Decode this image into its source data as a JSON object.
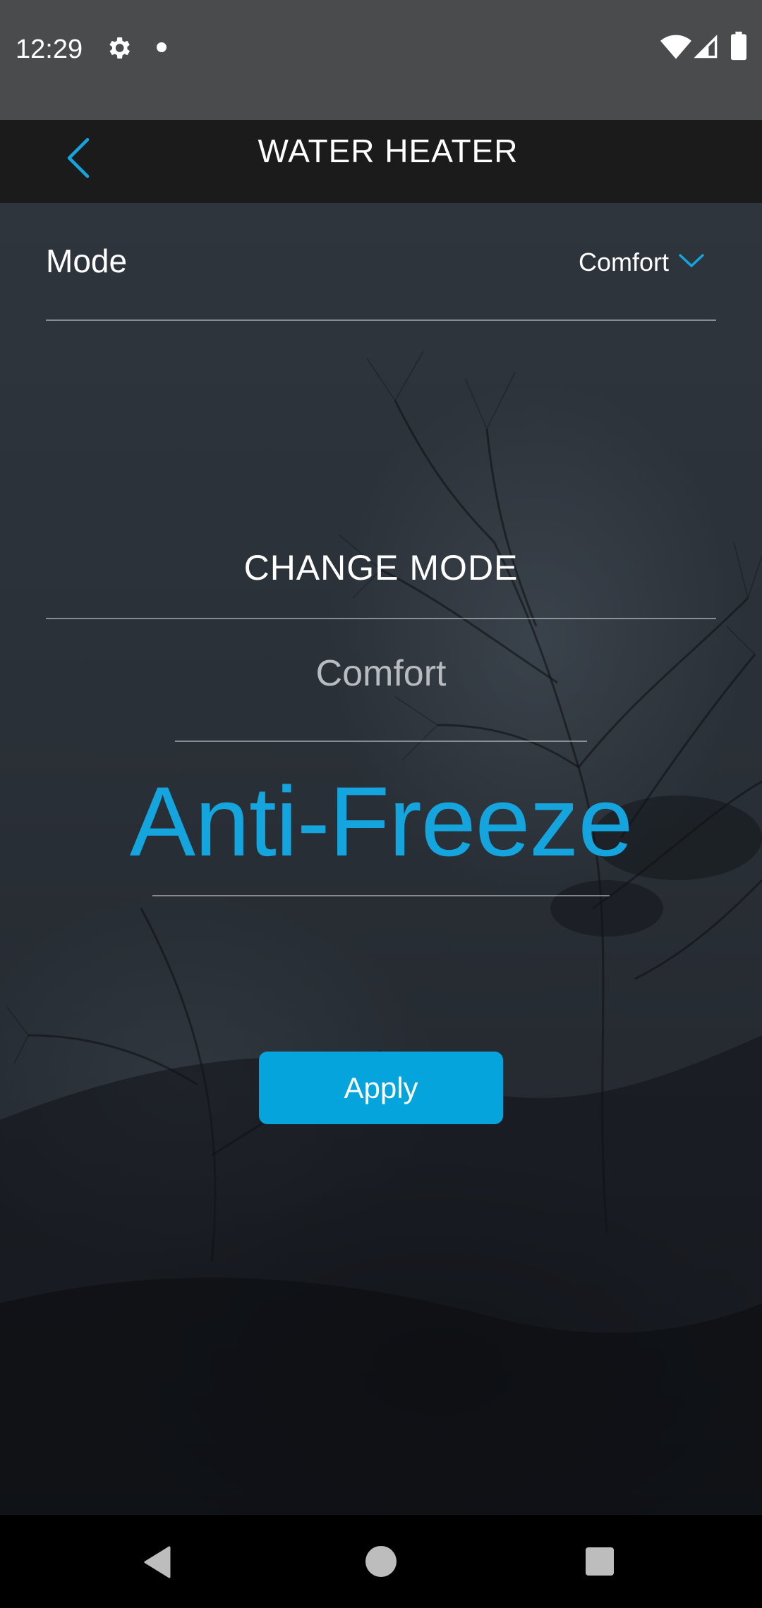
{
  "status_bar": {
    "time": "12:29",
    "icons": [
      "gear-icon",
      "notification-dot-icon",
      "wifi-icon",
      "cell-signal-icon",
      "battery-icon"
    ]
  },
  "header": {
    "title": "WATER HEATER",
    "back_icon": "chevron-left-icon"
  },
  "mode": {
    "label": "Mode",
    "selected_value": "Comfort",
    "dropdown_icon": "chevron-down-icon"
  },
  "change_mode": {
    "title": "CHANGE MODE",
    "options": [
      {
        "label": "Comfort",
        "selected": false
      },
      {
        "label": "Anti-Freeze",
        "selected": true
      }
    ],
    "apply_label": "Apply"
  },
  "nav_bar": {
    "icons": [
      "back-triangle-icon",
      "home-circle-icon",
      "recents-square-icon"
    ]
  },
  "colors": {
    "accent": "#05a4dc",
    "status_bar": "#4a4b4d",
    "header_bg": "#1b1b1c",
    "nav_bar": "#000000"
  }
}
